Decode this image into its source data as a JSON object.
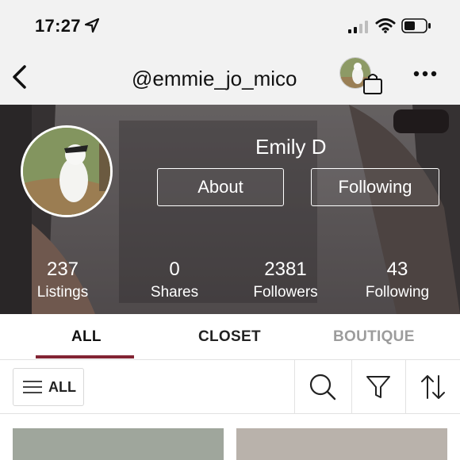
{
  "status_bar": {
    "time": "17:27",
    "icons": [
      "location-arrow-icon",
      "signal-icon",
      "wifi-icon",
      "battery-icon"
    ]
  },
  "nav": {
    "back_icon": "chevron-left-icon",
    "username": "@emmie_jo_mico",
    "bag_icon": "shopping-bag-icon",
    "more_icon": "more-dots-icon"
  },
  "profile": {
    "display_name": "Emily D",
    "about_label": "About",
    "following_button_label": "Following",
    "stats": [
      {
        "value": "237",
        "label": "Listings"
      },
      {
        "value": "0",
        "label": "Shares"
      },
      {
        "value": "2381",
        "label": "Followers"
      },
      {
        "value": "43",
        "label": "Following"
      }
    ]
  },
  "tabs": [
    {
      "label": "ALL",
      "active": true
    },
    {
      "label": "CLOSET",
      "active": false
    },
    {
      "label": "BOUTIQUE",
      "active": false
    }
  ],
  "filter_bar": {
    "all_label": "ALL",
    "icons": [
      "menu-icon",
      "search-icon",
      "filter-icon",
      "sort-icon"
    ]
  },
  "colors": {
    "accent": "#822433",
    "inactive_tab": "#9c9c9c",
    "chrome_bg": "#f2f2f2"
  }
}
